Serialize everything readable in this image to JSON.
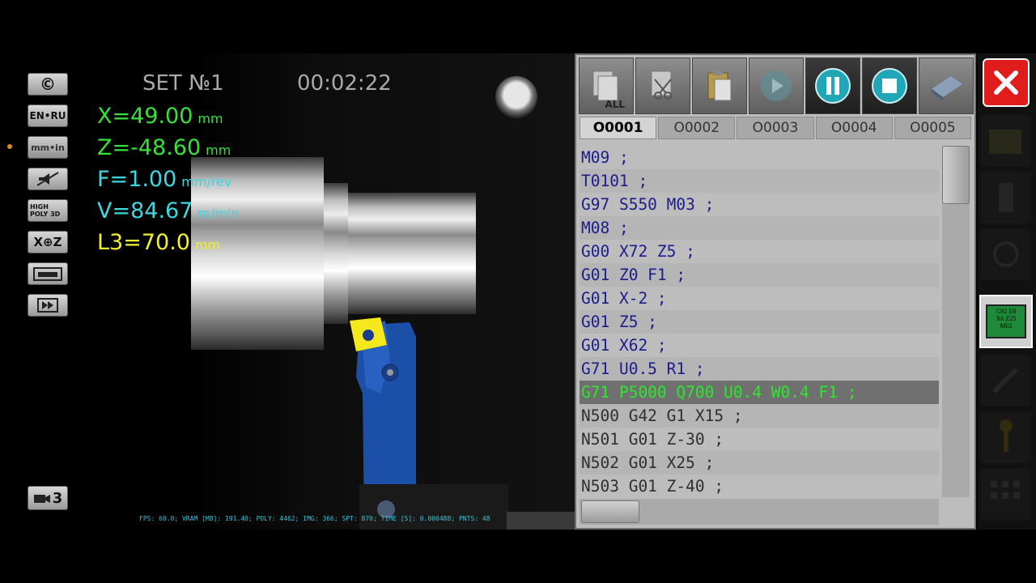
{
  "header": {
    "set_label": "SET №1",
    "timer": "00:02:22"
  },
  "left_toolbar": [
    {
      "id": "copyright",
      "label": "©"
    },
    {
      "id": "language",
      "label": "EN•RU"
    },
    {
      "id": "units",
      "label": "mm•in"
    },
    {
      "id": "sound",
      "label": ""
    },
    {
      "id": "quality",
      "label": "HIGH POLY 3D"
    },
    {
      "id": "axis",
      "label": "X⊕Z"
    },
    {
      "id": "machine",
      "label": ""
    },
    {
      "id": "playback",
      "label": ""
    }
  ],
  "readouts": {
    "x": {
      "value": "X=49.00",
      "unit": "mm"
    },
    "z": {
      "value": "Z=-48.60",
      "unit": "mm"
    },
    "f": {
      "value": "F=1.00",
      "unit": "mm/rev"
    },
    "v": {
      "value": "V=84.67",
      "unit": "m/min"
    },
    "l3": {
      "value": "L3=70.0",
      "unit": "mm"
    }
  },
  "camera": {
    "label": "3"
  },
  "status_line": "FPS: 60.0; VRAM [MB]: 191.40; POLY: 4462; IMG: 366; SPT: 870; TIME [S]: 0.000488; PNTS: 48",
  "editor": {
    "toolbar": [
      {
        "id": "select-all",
        "label": "ALL",
        "icon": "select-all-icon"
      },
      {
        "id": "cut",
        "label": "",
        "icon": "cut-icon"
      },
      {
        "id": "paste",
        "label": "",
        "icon": "paste-icon"
      },
      {
        "id": "play",
        "label": "",
        "icon": "play-icon"
      },
      {
        "id": "pause",
        "label": "",
        "icon": "pause-icon"
      },
      {
        "id": "stop",
        "label": "",
        "icon": "stop-icon"
      },
      {
        "id": "reset",
        "label": "",
        "icon": "eraser-icon"
      }
    ],
    "tabs": [
      "O0001",
      "O0002",
      "O0003",
      "O0004",
      "O0005"
    ],
    "selected_tab": "O0001",
    "lines": [
      "M09 ;",
      "T0101 ;",
      "G97 S550 M03 ;",
      "M08 ;",
      "G00 X72 Z5 ;",
      "G01 Z0 F1 ;",
      "G01 X-2 ;",
      "G01 Z5 ;",
      "G01 X62 ;",
      "G71 U0.5 R1 ;",
      "G71 P5000 Q700 U0.4 W0.4 F1 ;",
      "N500 G42 G1 X15 ;",
      "N501 G01 Z-30 ;",
      "N502 G01 X25 ;",
      "N503 G01 Z-40 ;"
    ],
    "highlight_index": 10
  },
  "right_panel": {
    "program_icon_text": [
      "G92 E0",
      "X0 Z25",
      "M02"
    ]
  },
  "colors": {
    "readout_green": "#36e23a",
    "readout_cyan": "#3ed7e0",
    "readout_yellow": "#f0f030",
    "close_red": "#e01c1c",
    "code_blue": "#1c1c8c",
    "active_green": "#2be82b"
  }
}
